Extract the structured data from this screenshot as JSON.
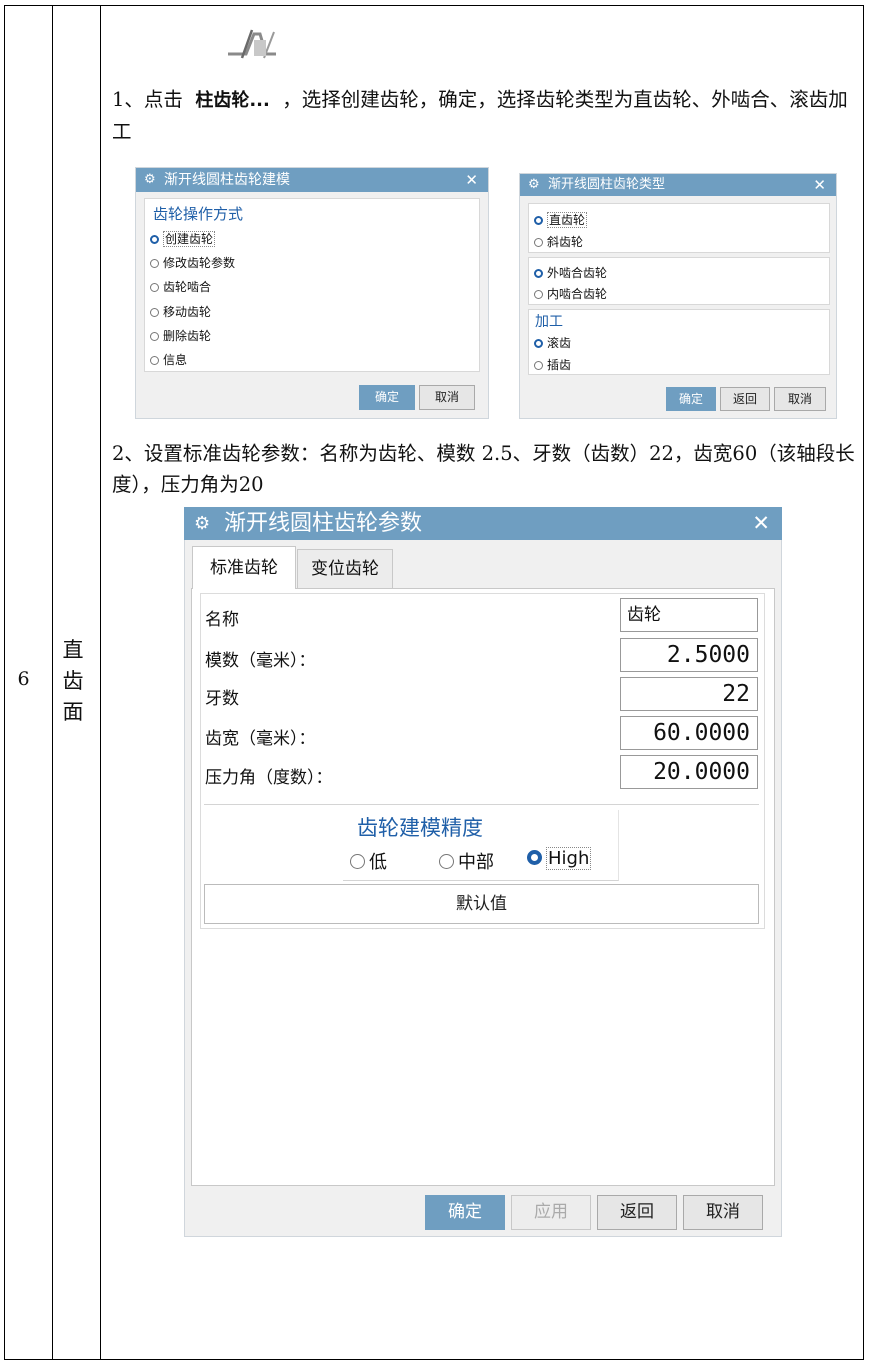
{
  "row": {
    "number": "6",
    "section": "直齿面"
  },
  "step1": {
    "text_before": "1、点击",
    "cmd": "柱齿轮...",
    "text_after": "，选择创建齿轮，确定，选择齿轮类型为直齿轮、外啮合、滚齿加工"
  },
  "dialog_modeling": {
    "title": "渐开线圆柱齿轮建模",
    "group": "齿轮操作方式",
    "options": [
      "创建齿轮",
      "修改齿轮参数",
      "齿轮啮合",
      "移动齿轮",
      "删除齿轮",
      "信息"
    ],
    "ok": "确定",
    "cancel": "取消"
  },
  "dialog_type": {
    "title": "渐开线圆柱齿轮类型",
    "tooth": [
      "直齿轮",
      "斜齿轮"
    ],
    "mesh": [
      "外啮合齿轮",
      "内啮合齿轮"
    ],
    "process_group": "加工",
    "process": [
      "滚齿",
      "插齿"
    ],
    "ok": "确定",
    "back": "返回",
    "cancel": "取消"
  },
  "step2": {
    "text": "2、设置标准齿轮参数：名称为齿轮、模数 2.5、牙数（齿数）22，齿宽60（该轴段长度），压力角为20"
  },
  "dialog_params": {
    "title": "渐开线圆柱齿轮参数",
    "tabs": [
      "标准齿轮",
      "变位齿轮"
    ],
    "fields": [
      {
        "label": "名称",
        "value": "齿轮"
      },
      {
        "label": "模数（毫米）：",
        "value": "2.5000"
      },
      {
        "label": "牙数",
        "value": "22"
      },
      {
        "label": "齿宽（毫米）：",
        "value": "60.0000"
      },
      {
        "label": "压力角（度数）：",
        "value": "20.0000"
      }
    ],
    "precision_group": "齿轮建模精度",
    "precision": [
      "低",
      "中部",
      "High"
    ],
    "default_button": "默认值",
    "buttons": {
      "ok": "确定",
      "apply": "应用",
      "back": "返回",
      "cancel": "取消"
    }
  },
  "colors": {
    "titlebar": "#6f9ec1",
    "accent": "#1f5fa8"
  }
}
